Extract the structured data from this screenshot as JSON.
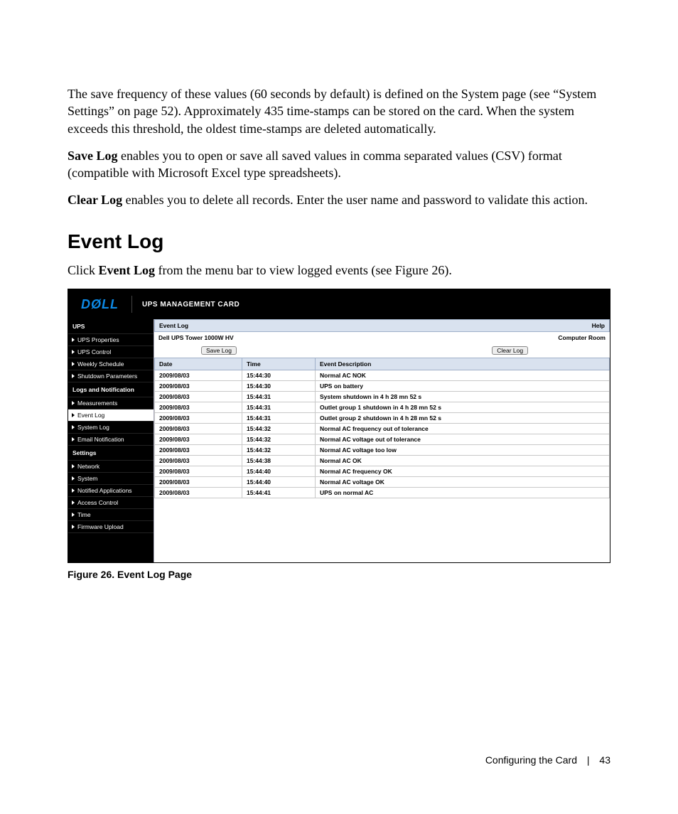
{
  "para1": "The save frequency of these values (60 seconds by default) is defined on the System page (see “System Settings” on page 52). Approximately 435 time-stamps can be stored on the card. When the system exceeds this threshold, the oldest time-stamps are deleted automatically.",
  "saveLog": {
    "lead": "Save Log",
    "rest": " enables you to open or save all saved values in comma separated values (CSV) format (compatible with Microsoft Excel type spreadsheets)."
  },
  "clearLog": {
    "lead": "Clear Log",
    "rest": " enables you to delete all records. Enter the user name and password to validate this action."
  },
  "heading": "Event Log",
  "clickLine": {
    "a": "Click ",
    "b": "Event Log",
    "c": " from the menu bar to view logged events (see Figure 26)."
  },
  "figcap": "Figure 26. Event Log Page",
  "footer": {
    "section": "Configuring the Card",
    "sep": "|",
    "page": "43"
  },
  "screenshot": {
    "logo": "DØLL",
    "headerTitle": "UPS MANAGEMENT CARD",
    "sidebar": [
      {
        "type": "group",
        "label": "UPS"
      },
      {
        "type": "item",
        "label": "UPS Properties"
      },
      {
        "type": "item",
        "label": "UPS Control"
      },
      {
        "type": "item",
        "label": "Weekly Schedule"
      },
      {
        "type": "item",
        "label": "Shutdown Parameters"
      },
      {
        "type": "group",
        "label": "Logs and Notification"
      },
      {
        "type": "item",
        "label": "Measurements"
      },
      {
        "type": "item",
        "label": "Event Log",
        "active": true
      },
      {
        "type": "item",
        "label": "System Log"
      },
      {
        "type": "item",
        "label": "Email Notification"
      },
      {
        "type": "group",
        "label": "Settings"
      },
      {
        "type": "item",
        "label": "Network"
      },
      {
        "type": "item",
        "label": "System"
      },
      {
        "type": "item",
        "label": "Notified Applications"
      },
      {
        "type": "item",
        "label": "Access Control"
      },
      {
        "type": "item",
        "label": "Time"
      },
      {
        "type": "item",
        "label": "Firmware Upload"
      }
    ],
    "titlebar": {
      "left": "Event Log",
      "right": "Help"
    },
    "subbar": {
      "left": "Dell UPS Tower 1000W HV",
      "right": "Computer Room"
    },
    "buttons": {
      "save": "Save Log",
      "clear": "Clear Log"
    },
    "columns": {
      "date": "Date",
      "time": "Time",
      "desc": "Event Description"
    },
    "rows": [
      {
        "date": "2009/08/03",
        "time": "15:44:30",
        "desc": "Normal AC NOK"
      },
      {
        "date": "2009/08/03",
        "time": "15:44:30",
        "desc": "UPS on battery"
      },
      {
        "date": "2009/08/03",
        "time": "15:44:31",
        "desc": "System shutdown in 4 h 28 mn 52 s"
      },
      {
        "date": "2009/08/03",
        "time": "15:44:31",
        "desc": "Outlet group 1 shutdown in 4 h 28 mn 52 s"
      },
      {
        "date": "2009/08/03",
        "time": "15:44:31",
        "desc": "Outlet group 2 shutdown in 4 h 28 mn 52 s"
      },
      {
        "date": "2009/08/03",
        "time": "15:44:32",
        "desc": "Normal AC frequency out of tolerance"
      },
      {
        "date": "2009/08/03",
        "time": "15:44:32",
        "desc": "Normal AC voltage out of tolerance"
      },
      {
        "date": "2009/08/03",
        "time": "15:44:32",
        "desc": "Normal AC voltage too low"
      },
      {
        "date": "2009/08/03",
        "time": "15:44:38",
        "desc": "Normal AC OK"
      },
      {
        "date": "2009/08/03",
        "time": "15:44:40",
        "desc": "Normal AC frequency OK"
      },
      {
        "date": "2009/08/03",
        "time": "15:44:40",
        "desc": "Normal AC voltage OK"
      },
      {
        "date": "2009/08/03",
        "time": "15:44:41",
        "desc": "UPS on normal AC"
      }
    ]
  }
}
